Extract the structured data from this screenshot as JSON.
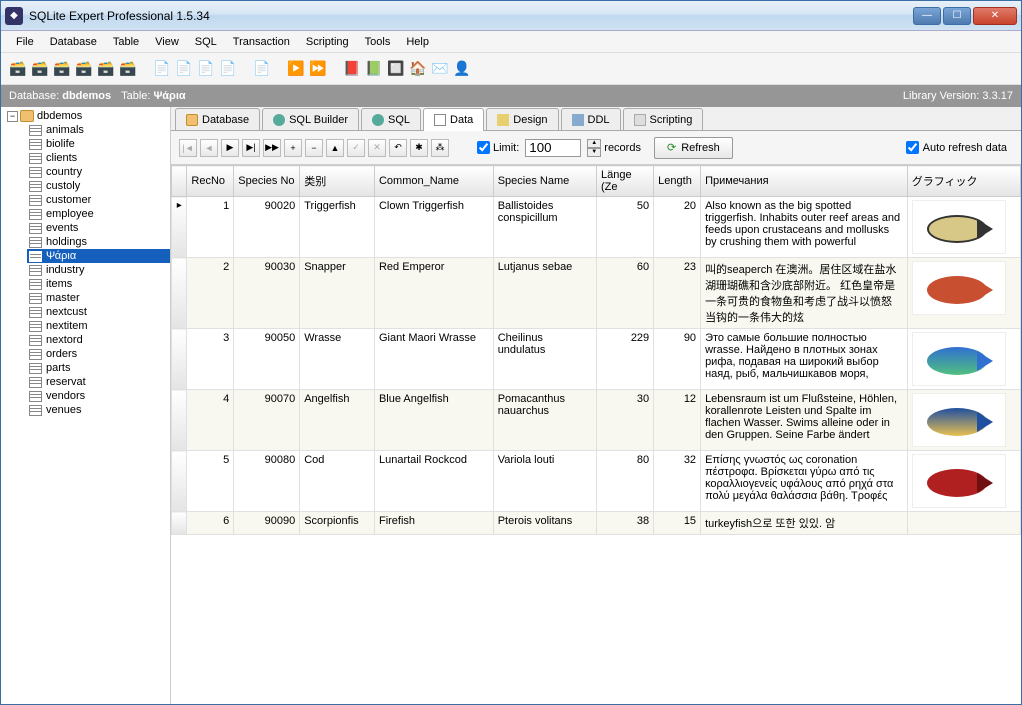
{
  "title": "SQLite Expert Professional 1.5.34",
  "menu": [
    "File",
    "Database",
    "Table",
    "View",
    "SQL",
    "Transaction",
    "Scripting",
    "Tools",
    "Help"
  ],
  "status": {
    "db_label": "Database:",
    "db": "dbdemos",
    "table_label": "Table:",
    "table": "Ψάρια",
    "lib_label": "Library Version:",
    "lib": "3.3.17"
  },
  "tree": {
    "db": "dbdemos",
    "tables": [
      "animals",
      "biolife",
      "clients",
      "country",
      "custoly",
      "customer",
      "employee",
      "events",
      "holdings",
      "Ψάρια",
      "industry",
      "items",
      "master",
      "nextcust",
      "nextitem",
      "nextord",
      "orders",
      "parts",
      "reservat",
      "vendors",
      "venues"
    ],
    "selected": "Ψάρια"
  },
  "tabs": [
    "Database",
    "SQL Builder",
    "SQL",
    "Data",
    "Design",
    "DDL",
    "Scripting"
  ],
  "active_tab": "Data",
  "gridbar": {
    "limit_label": "Limit:",
    "limit_value": "100",
    "records_label": "records",
    "refresh": "Refresh",
    "auto_refresh": "Auto refresh data"
  },
  "columns": [
    "",
    "RecNo",
    "Species No",
    "类别",
    "Common_Name",
    "Species Name",
    "Länge (Ze",
    "Length",
    "Примечания",
    "グラフィック"
  ],
  "rows": [
    {
      "recno": "1",
      "specno": "90020",
      "cat": "Triggerfish",
      "common": "Clown Triggerfish",
      "specname": "Ballistoides conspicillum",
      "len": "50",
      "lenin": "20",
      "notes": "Also known as the big spotted triggerfish.  Inhabits outer reef areas and feeds upon crustaceans and mollusks by crushing them with powerful",
      "fish": "f1",
      "ind": "▸"
    },
    {
      "recno": "2",
      "specno": "90030",
      "cat": "Snapper",
      "common": "Red Emperor",
      "specname": "Lutjanus sebae",
      "len": "60",
      "lenin": "23",
      "notes": "叫的seaperch 在澳洲。居住区域在盐水湖珊瑚礁和含沙底部附近。 红色皇帝是一条可贵的食物鱼和考虑了战斗以愤怒当钩的一条伟大的炫",
      "fish": "f2",
      "ind": ""
    },
    {
      "recno": "3",
      "specno": "90050",
      "cat": "Wrasse",
      "common": "Giant Maori Wrasse",
      "specname": "Cheilinus undulatus",
      "len": "229",
      "lenin": "90",
      "notes": "Это самые большие полностью wrasse. Найдено в плотных зонах рифа, подавая на широкий выбор наяд, рыб, мальчишкавов моря,",
      "fish": "f3",
      "ind": ""
    },
    {
      "recno": "4",
      "specno": "90070",
      "cat": "Angelfish",
      "common": "Blue Angelfish",
      "specname": "Pomacanthus nauarchus",
      "len": "30",
      "lenin": "12",
      "notes": "Lebensraum ist um Flußsteine, Höhlen, korallenrote Leisten und Spalte im flachen Wasser. Swims alleine oder in den Gruppen. Seine Farbe ändert",
      "fish": "f4",
      "ind": ""
    },
    {
      "recno": "5",
      "specno": "90080",
      "cat": "Cod",
      "common": "Lunartail Rockcod",
      "specname": "Variola louti",
      "len": "80",
      "lenin": "32",
      "notes": "Επίσης γνωστός ως coronation πέστροφα. Βρίσκεται γύρω από τις κοραλλιογενείς υφάλους από ρηχά στα πολύ μεγάλα θαλάσσια βάθη. Τροφές",
      "fish": "f5",
      "ind": ""
    },
    {
      "recno": "6",
      "specno": "90090",
      "cat": "Scorpionfis",
      "common": "Firefish",
      "specname": "Pterois volitans",
      "len": "38",
      "lenin": "15",
      "notes": "turkeyfish으로 또한 있있. 암",
      "fish": "",
      "ind": ""
    }
  ]
}
